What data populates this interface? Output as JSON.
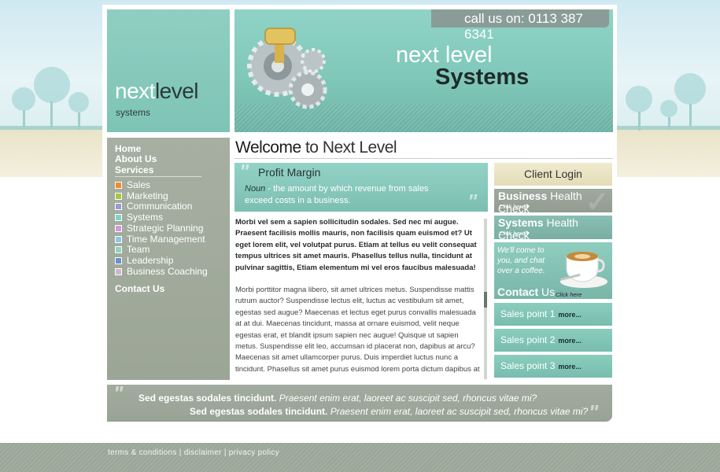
{
  "logo": {
    "word_light": "next",
    "word_dark": "level",
    "sub": "systems"
  },
  "banner": {
    "phone": "call us on: 0113 387 6341",
    "line1": "next level",
    "line2": "Systems"
  },
  "nav": {
    "main": [
      "Home",
      "About Us",
      "Services"
    ],
    "items": [
      {
        "label": "Sales",
        "color": "#f08a2e"
      },
      {
        "label": "Marketing",
        "color": "#a8c83a"
      },
      {
        "label": "Communication",
        "color": "#9a9ad6"
      },
      {
        "label": "Systems",
        "color": "#7fd3c6"
      },
      {
        "label": "Strategic Planning",
        "color": "#d39ad8"
      },
      {
        "label": "Time Management",
        "color": "#8fc6e8"
      },
      {
        "label": "Team",
        "color": "#8fd3bf"
      },
      {
        "label": "Leadership",
        "color": "#6b8fc8"
      },
      {
        "label": "Business Coaching",
        "color": "#c9b9cf"
      }
    ],
    "contact": "Contact Us"
  },
  "welcome": {
    "bold": "Welcome",
    "rest": " to Next Level"
  },
  "profit_margin": {
    "title": "Profit Margin",
    "noun": "Noun",
    "definition": " - the amount by which revenue from sales exceed costs in a business."
  },
  "article": {
    "lead": "Morbi vel sem a sapien sollicitudin sodales. Sed nec mi augue. Praesent facilisis mollis mauris, non facilisis quam euismod et? Ut eget lorem elit, vel volutpat purus. Etiam at tellus eu velit consequat tempus ultrices sit amet mauris. Phasellus tellus nulla, tincidunt at pulvinar sagittis, Etiam elementum mi vel eros faucibus malesuada!",
    "body": "Morbi porttitor magna libero, sit amet ultrices metus. Suspendisse mattis rutrum auctor? Suspendisse lectus elit, luctus ac vestibulum sit amet, egestas sed augue? Maecenas et lectus eget purus convallis malesuada at at dui. Maecenas tincidunt, massa at ornare euismod, velit neque egestas erat, et blandit ipsum sapien nec augue! Quisque ut sapien metus. Suspendisse elit leo, accumsan id placerat non, dapibus at arcu? Maecenas sit amet ullamcorper purus. Duis imperdiet luctus nunc a tincidunt. Phasellus sit amet purus euismod lorem porta dictum dapibus at"
  },
  "right": {
    "login": "Client Login",
    "business_hc": {
      "bold": "Business",
      "rest": " Health Check",
      "click": "Click here"
    },
    "systems_hc": {
      "bold": "Systems",
      "rest": " Health Check",
      "click": "Click here"
    },
    "contact": {
      "text": "We'll come to you, and chat over a coffee.",
      "bold": "Contact",
      "rest": " Us",
      "click": "Click here"
    },
    "sales_points": [
      {
        "label": "Sales point 1",
        "more": "more..."
      },
      {
        "label": "Sales point 2",
        "more": "more..."
      },
      {
        "label": "Sales point 3",
        "more": "more..."
      }
    ]
  },
  "quote": {
    "line1_bold": "Sed egestas sodales tincidunt.",
    "line1_italic": " Praesent enim erat, laoreet ac suscipit sed, rhoncus vitae mi?",
    "line2_bold": "Sed egestas sodales tincidunt.",
    "line2_italic": " Praesent enim erat, laoreet ac suscipit sed, rhoncus vitae mi?"
  },
  "footer": {
    "terms": "terms & conditions",
    "disclaimer": "disclaimer",
    "privacy": "privacy policy",
    "sep": " | "
  }
}
